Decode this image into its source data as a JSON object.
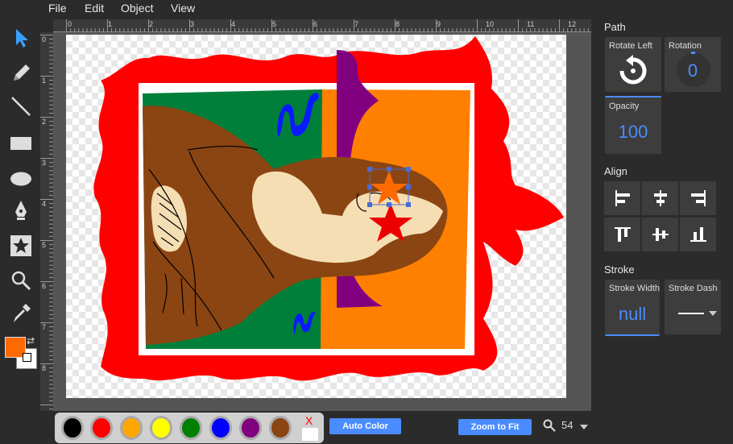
{
  "menu": [
    "File",
    "Edit",
    "Object",
    "View"
  ],
  "tools": [
    "select-tool",
    "pencil-tool",
    "line-tool",
    "rectangle-tool",
    "ellipse-tool",
    "pen-tool",
    "star-tool",
    "zoom-tool",
    "eyedropper-tool"
  ],
  "colors": {
    "fill": "#ff6a00",
    "stroke": "#ffffff",
    "accent": "#4a8cff"
  },
  "ruler": {
    "top_ticks": [
      "0",
      "1",
      "2",
      "3",
      "4",
      "5",
      "6",
      "7",
      "8",
      "9",
      "10",
      "11",
      "12"
    ],
    "left_ticks": [
      "0",
      "1",
      "2",
      "3",
      "4",
      "5",
      "6",
      "7",
      "8"
    ]
  },
  "panel": {
    "path_title": "Path",
    "rotate_left_label": "Rotate Left",
    "rotation_label": "Rotation",
    "rotation_value": "0",
    "opacity_label": "Opacity",
    "opacity_value": "100",
    "align_title": "Align",
    "stroke_title": "Stroke",
    "stroke_width_label": "Stroke Width",
    "stroke_width_value": "null",
    "stroke_dash_label": "Stroke Dash"
  },
  "palette": {
    "swatches": [
      "#000000",
      "#ff0000",
      "#ffa500",
      "#ffff00",
      "#008000",
      "#0000ff",
      "#800080",
      "#8b4513"
    ],
    "none_label": "X"
  },
  "bottom": {
    "auto_color_label": "Auto Color",
    "zoom_fit_label": "Zoom to Fit",
    "zoom_value": "54"
  }
}
